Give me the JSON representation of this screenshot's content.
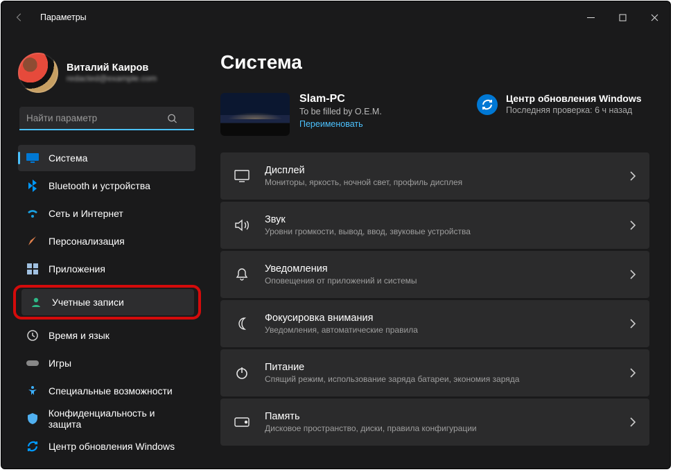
{
  "titlebar": {
    "title": "Параметры"
  },
  "profile": {
    "name": "Виталий Каиров",
    "email": "redacted@example.com"
  },
  "search": {
    "placeholder": "Найти параметр"
  },
  "sidebar": {
    "items": [
      {
        "label": "Система",
        "icon": "monitor-icon",
        "active": true,
        "color": "#4cc2ff"
      },
      {
        "label": "Bluetooth и устройства",
        "icon": "bluetooth-icon",
        "color": "#0099ff"
      },
      {
        "label": "Сеть и Интернет",
        "icon": "wifi-icon",
        "color": "#1aa0e0"
      },
      {
        "label": "Персонализация",
        "icon": "brush-icon",
        "color": "#e06040"
      },
      {
        "label": "Приложения",
        "icon": "apps-icon",
        "color": "#a0c0e0"
      },
      {
        "label": "Учетные записи",
        "icon": "person-icon",
        "highlight": true,
        "color": "#2eb886"
      },
      {
        "label": "Время и язык",
        "icon": "clock-icon",
        "color": "#d0d0d0"
      },
      {
        "label": "Игры",
        "icon": "gamepad-icon",
        "color": "#888"
      },
      {
        "label": "Специальные возможности",
        "icon": "accessibility-icon",
        "color": "#3cb0ff"
      },
      {
        "label": "Конфиденциальность и защита",
        "icon": "shield-icon",
        "color": "#50b0f0"
      },
      {
        "label": "Центр обновления Windows",
        "icon": "sync-icon",
        "color": "#0078d4"
      }
    ]
  },
  "content": {
    "page_title": "Система",
    "device": {
      "name": "Slam-PC",
      "sub": "To be filled by O.E.M.",
      "rename": "Переименовать"
    },
    "update": {
      "title": "Центр обновления Windows",
      "sub": "Последняя проверка: 6 ч назад"
    },
    "cards": [
      {
        "icon": "display-icon",
        "title": "Дисплей",
        "desc": "Мониторы, яркость, ночной свет, профиль дисплея"
      },
      {
        "icon": "sound-icon",
        "title": "Звук",
        "desc": "Уровни громкости, вывод, ввод, звуковые устройства"
      },
      {
        "icon": "bell-icon",
        "title": "Уведомления",
        "desc": "Оповещения от приложений и системы"
      },
      {
        "icon": "moon-icon",
        "title": "Фокусировка внимания",
        "desc": "Уведомления, автоматические правила"
      },
      {
        "icon": "power-icon",
        "title": "Питание",
        "desc": "Спящий режим, использование заряда батареи, экономия заряда"
      },
      {
        "icon": "storage-icon",
        "title": "Память",
        "desc": "Дисковое пространство, диски, правила конфигурации"
      }
    ]
  }
}
